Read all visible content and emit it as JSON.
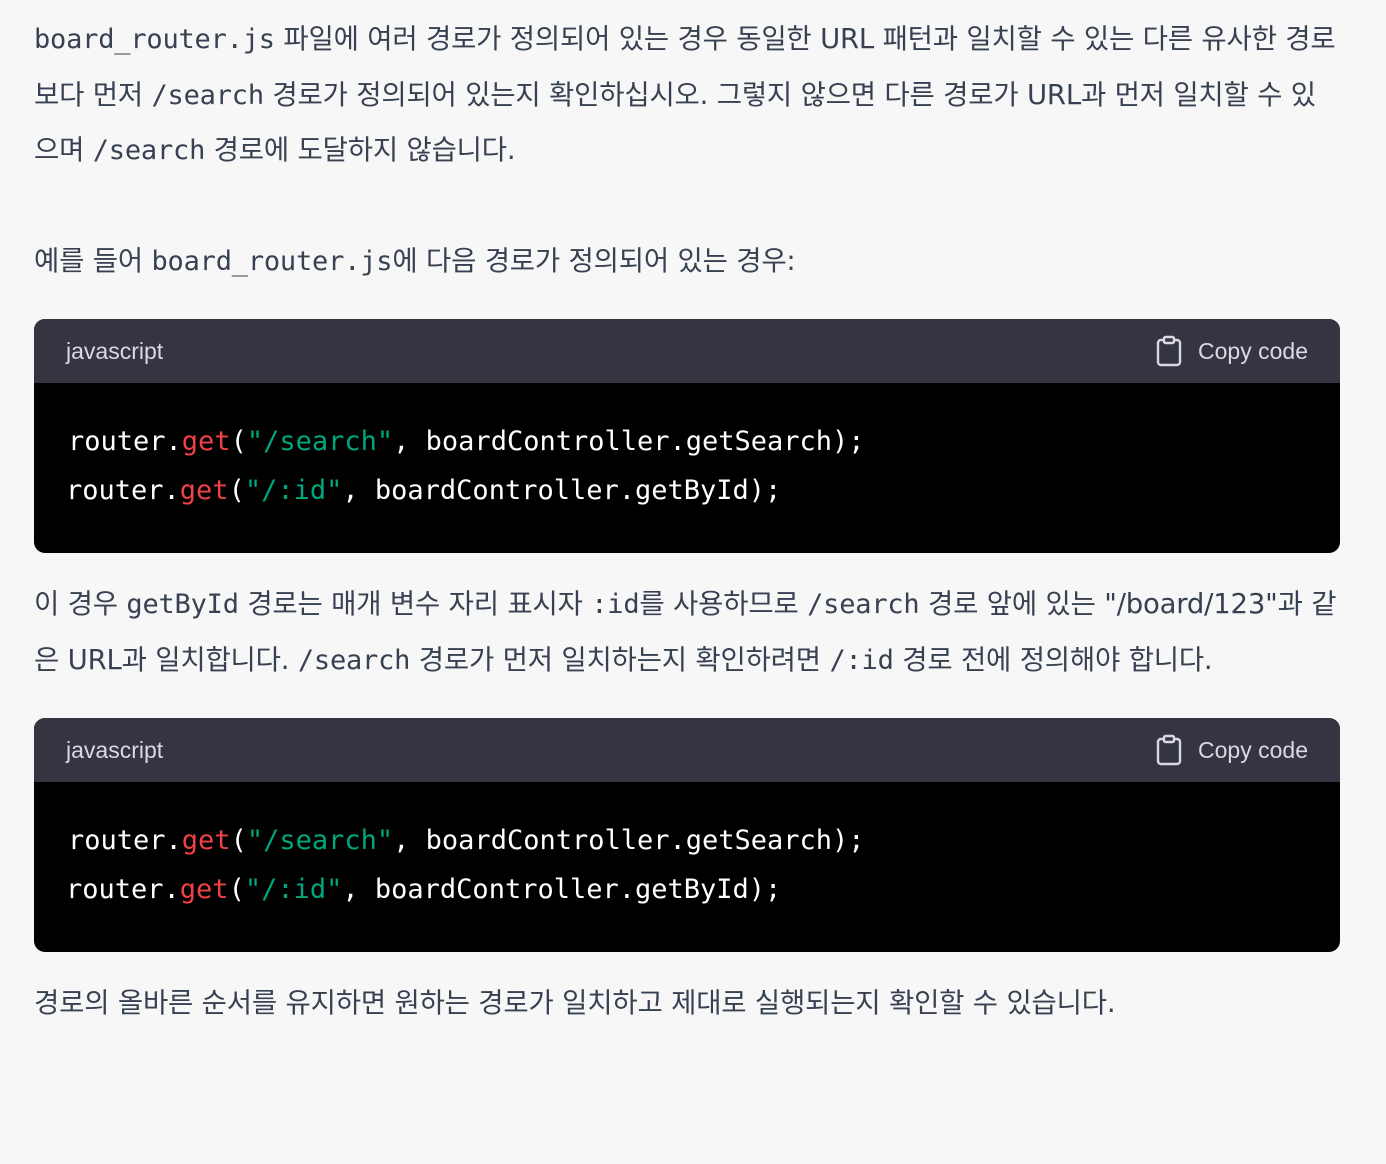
{
  "paragraphs": {
    "p1": {
      "code1": "board_router.js",
      "text1": " 파일에 여러 경로가 정의되어 있는 경우 동일한 URL 패턴과 일치할 수 있는 다른 유사한 경로보다 먼저 ",
      "code2": "/search",
      "text2": " 경로가 정의되어 있는지 확인하십시오. 그렇지 않으면 다른 경로가 URL과 먼저 일치할 수 있으며 ",
      "code3": "/search",
      "text3": " 경로에 도달하지 않습니다."
    },
    "p2": {
      "text1": "예를 들어 ",
      "code1": "board_router.js",
      "text2": "에 다음 경로가 정의되어 있는 경우:"
    },
    "p3": {
      "text1": "이 경우 ",
      "code1": "getById",
      "text2": " 경로는 매개 변수 자리 표시자 ",
      "code2": ":id",
      "text3": "를 사용하므로 ",
      "code3": "/search",
      "text4": " 경로 앞에 있는 \"/board/123\"과 같은 URL과 일치합니다. ",
      "code4": "/search",
      "text5": " 경로가 먼저 일치하는지 확인하려면 ",
      "code5": "/:id",
      "text6": " 경로 전에 정의해야 합니다."
    },
    "p4": {
      "text1": "경로의 올바른 순서를 유지하면 원하는 경로가 일치하고 제대로 실행되는지 확인할 수 있습니다."
    }
  },
  "code_blocks": [
    {
      "language": "javascript",
      "copy_label": "Copy code",
      "line1": {
        "obj": "router.",
        "fn": "get",
        "open": "(",
        "str": "\"/search\"",
        "rest": ", boardController.getSearch);"
      },
      "line2": {
        "obj": "router.",
        "fn": "get",
        "open": "(",
        "str": "\"/:id\"",
        "rest": ", boardController.getById);"
      }
    },
    {
      "language": "javascript",
      "copy_label": "Copy code",
      "line1": {
        "obj": "router.",
        "fn": "get",
        "open": "(",
        "str": "\"/search\"",
        "rest": ", boardController.getSearch);"
      },
      "line2": {
        "obj": "router.",
        "fn": "get",
        "open": "(",
        "str": "\"/:id\"",
        "rest": ", boardController.getById);"
      }
    }
  ],
  "colors": {
    "background": "#f7f7f8",
    "text": "#374151",
    "code_header": "#343541",
    "code_body": "#000000",
    "keyword_fn": "#ef4146",
    "string": "#00a67d"
  },
  "icons": {
    "copy": "clipboard-icon"
  }
}
